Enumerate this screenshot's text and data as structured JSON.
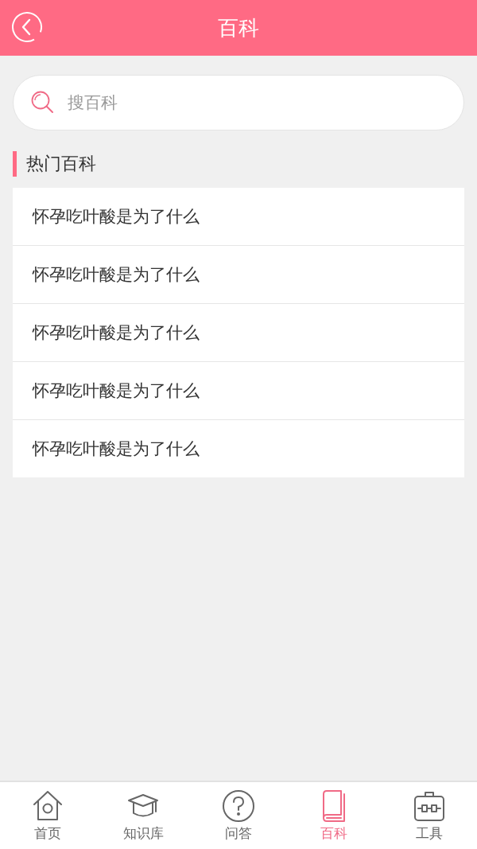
{
  "header": {
    "title": "百科"
  },
  "search": {
    "placeholder": "搜百科"
  },
  "section": {
    "title": "热门百科"
  },
  "articles": [
    {
      "title": "怀孕吃叶酸是为了什么"
    },
    {
      "title": "怀孕吃叶酸是为了什么"
    },
    {
      "title": "怀孕吃叶酸是为了什么"
    },
    {
      "title": "怀孕吃叶酸是为了什么"
    },
    {
      "title": "怀孕吃叶酸是为了什么"
    }
  ],
  "tabs": [
    {
      "label": "首页",
      "selected": false
    },
    {
      "label": "知识库",
      "selected": false
    },
    {
      "label": "问答",
      "selected": false
    },
    {
      "label": "百科",
      "selected": true
    },
    {
      "label": "工具",
      "selected": false
    }
  ]
}
